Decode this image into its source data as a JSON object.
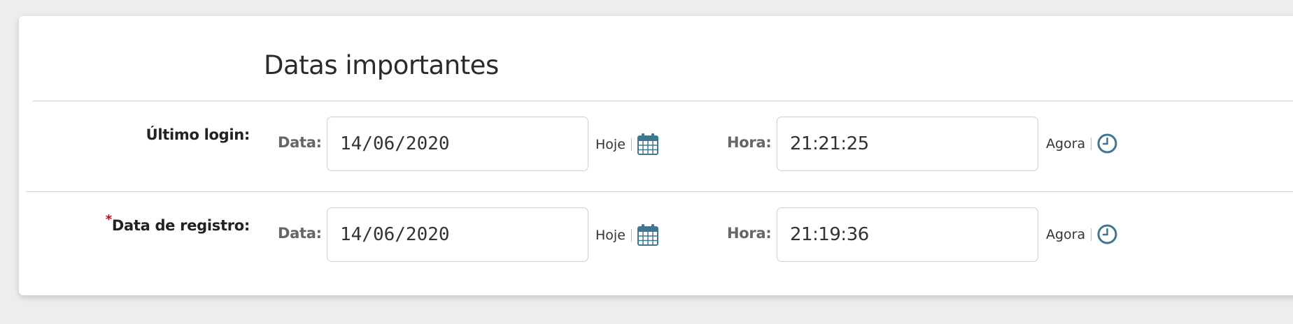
{
  "section": {
    "title": "Datas importantes"
  },
  "rows": [
    {
      "label": "Último login:",
      "required": false,
      "date_label": "Data:",
      "date_value": "14/06/2020",
      "today_link": "Hoje",
      "time_label": "Hora:",
      "time_value": "21:21:25",
      "now_link": "Agora"
    },
    {
      "label": "Data de registro:",
      "required": true,
      "required_mark": "*",
      "date_label": "Data:",
      "date_value": "14/06/2020",
      "today_link": "Hoje",
      "time_label": "Hora:",
      "time_value": "21:19:36",
      "now_link": "Agora"
    }
  ],
  "icons": {
    "calendar": "calendar-icon",
    "clock": "clock-icon"
  },
  "colors": {
    "icon_blue": "#417690",
    "required_red": "#d0021b"
  }
}
